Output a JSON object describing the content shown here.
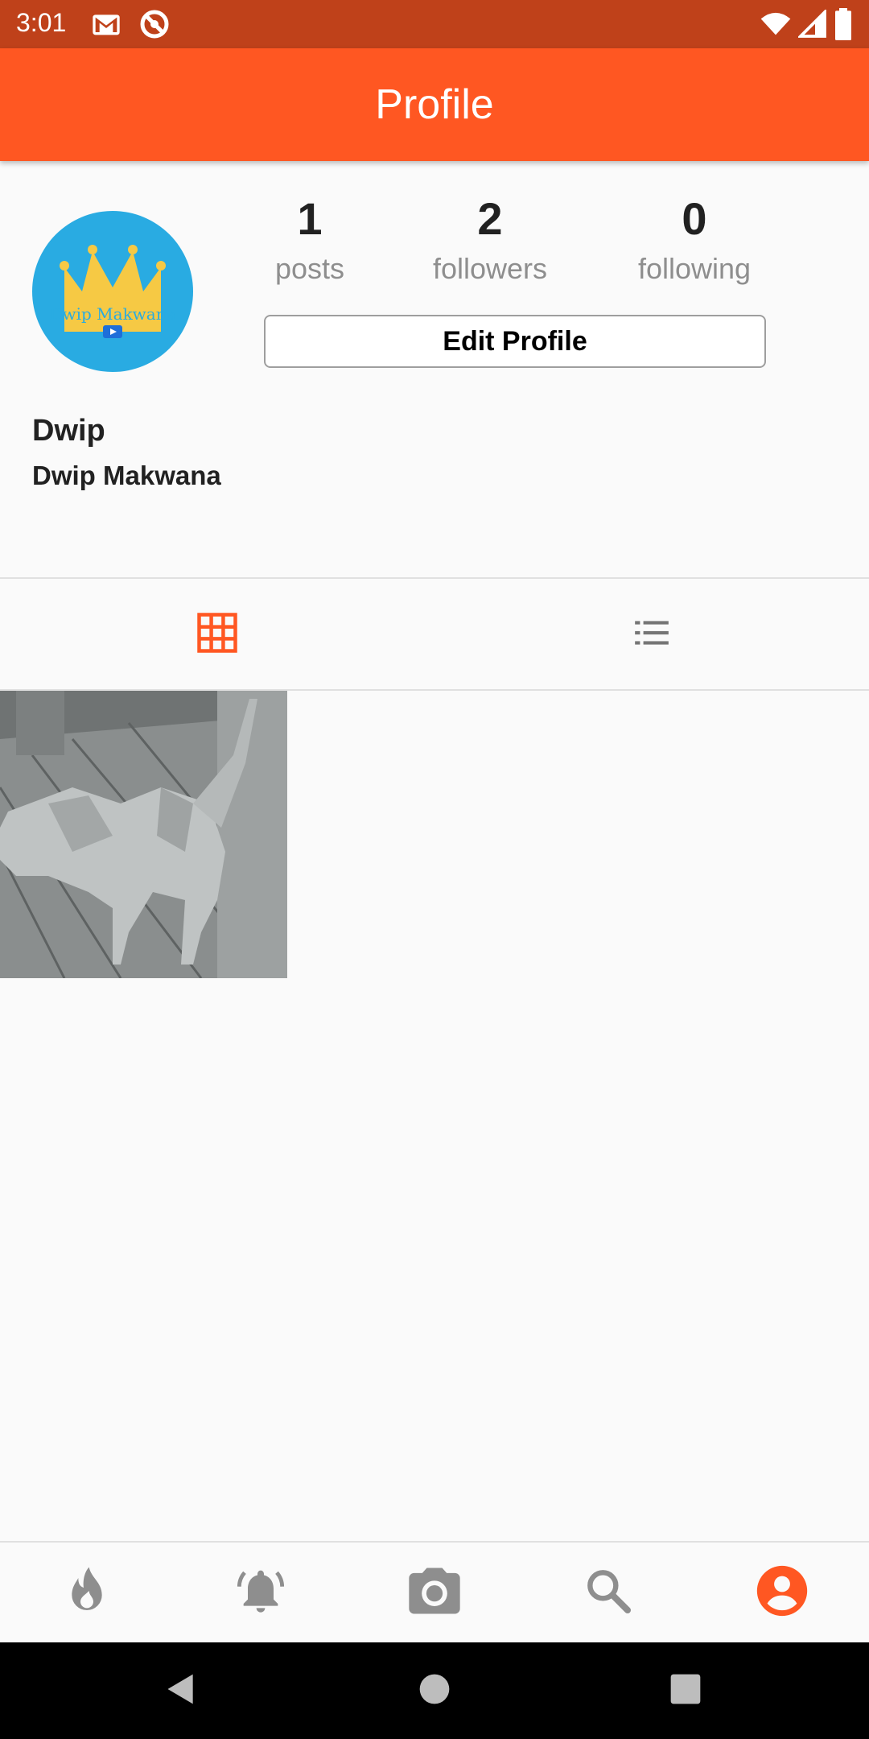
{
  "status_bar": {
    "time": "3:01",
    "left_icons": [
      "gmail-icon",
      "data-saver-icon"
    ],
    "right_icons": [
      "wifi-icon",
      "cellular-signal-icon",
      "battery-icon"
    ]
  },
  "app_bar": {
    "title": "Profile"
  },
  "colors": {
    "accent": "#ff5722",
    "status_bar": "#bf411a",
    "muted": "#8e8e8e"
  },
  "profile": {
    "avatar_text": "Dwip Makwana",
    "stats": [
      {
        "count": "1",
        "label": "posts"
      },
      {
        "count": "2",
        "label": "followers"
      },
      {
        "count": "0",
        "label": "following"
      }
    ],
    "edit_button_label": "Edit Profile",
    "username": "Dwip",
    "full_name": "Dwip Makwana"
  },
  "view_tabs": [
    {
      "icon": "grid-icon",
      "selected": true
    },
    {
      "icon": "list-icon",
      "selected": false
    }
  ],
  "bottom_nav": [
    {
      "icon": "flame-icon",
      "selected": false
    },
    {
      "icon": "notification-bell-icon",
      "selected": false
    },
    {
      "icon": "camera-icon",
      "selected": false
    },
    {
      "icon": "search-icon",
      "selected": false
    },
    {
      "icon": "account-circle-icon",
      "selected": true
    }
  ],
  "system_nav": [
    "back-icon",
    "home-icon",
    "recents-icon"
  ]
}
